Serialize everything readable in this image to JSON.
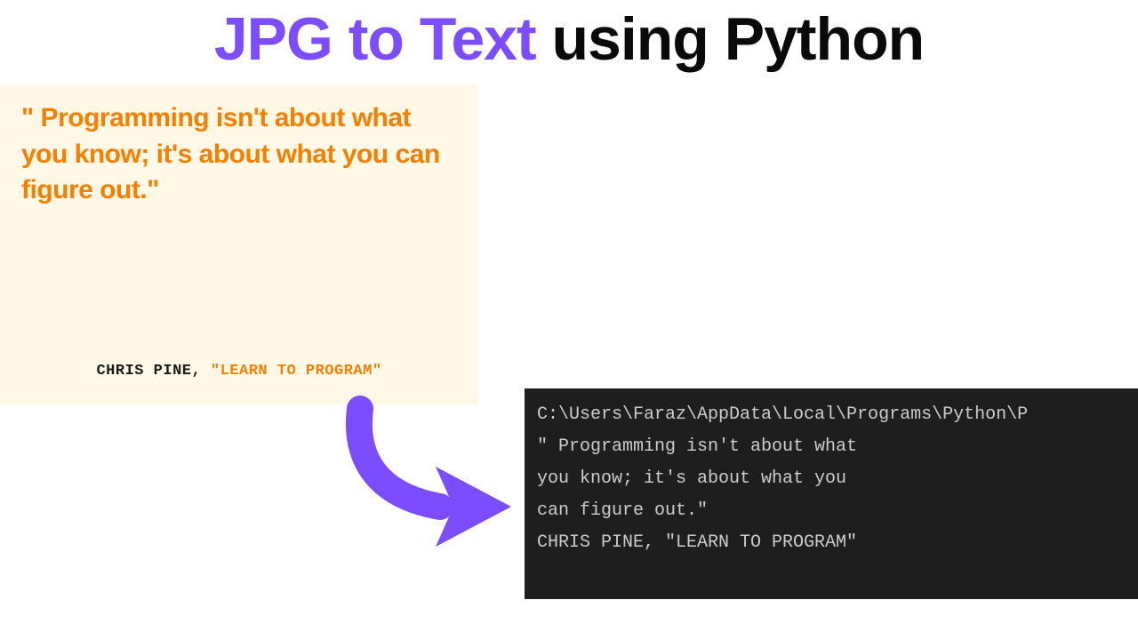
{
  "title": {
    "purple": "JPG to Text",
    "black": " using Python"
  },
  "quote_card": {
    "text": "\" Programming isn't about what you know; it's about what you can figure out.\"",
    "author": "CHRIS PINE, ",
    "book": "\"LEARN TO PROGRAM\""
  },
  "terminal": {
    "line1": "C:\\Users\\Faraz\\AppData\\Local\\Programs\\Python\\P",
    "line2": "\" Programming isn't about what",
    "line3": "you know; it's about what you",
    "line4": "can figure out.\"",
    "line5": "",
    "line6": "CHRIS PINE, \"LEARN TO PROGRAM\""
  },
  "colors": {
    "purple": "#7c4dff",
    "orange": "#f77f00",
    "cream": "#fff8e7",
    "terminal_bg": "#1e1e1e",
    "terminal_fg": "#cccccc"
  }
}
